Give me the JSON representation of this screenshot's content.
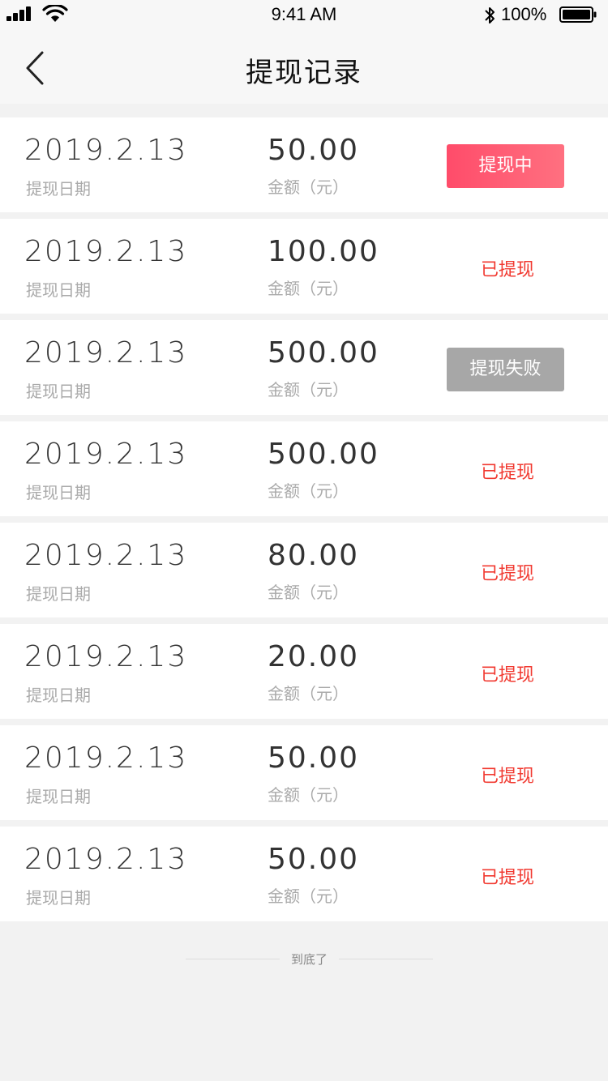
{
  "status_bar": {
    "time": "9:41 AM",
    "battery_percent": "100%"
  },
  "nav": {
    "title": "提现记录",
    "back_icon": "chevron-left-icon"
  },
  "labels": {
    "date_label": "提现日期",
    "amount_label": "金额（元）"
  },
  "records": [
    {
      "date": "2019.2.13",
      "amount": "50.00",
      "status": "提现中",
      "status_type": "pending"
    },
    {
      "date": "2019.2.13",
      "amount": "100.00",
      "status": "已提现",
      "status_type": "done"
    },
    {
      "date": "2019.2.13",
      "amount": "500.00",
      "status": "提现失败",
      "status_type": "failed"
    },
    {
      "date": "2019.2.13",
      "amount": "500.00",
      "status": "已提现",
      "status_type": "done"
    },
    {
      "date": "2019.2.13",
      "amount": "80.00",
      "status": "已提现",
      "status_type": "done"
    },
    {
      "date": "2019.2.13",
      "amount": "20.00",
      "status": "已提现",
      "status_type": "done"
    },
    {
      "date": "2019.2.13",
      "amount": "50.00",
      "status": "已提现",
      "status_type": "done"
    },
    {
      "date": "2019.2.13",
      "amount": "50.00",
      "status": "已提现",
      "status_type": "done"
    }
  ],
  "footer": {
    "end_text": "到底了"
  },
  "colors": {
    "pending_bg": "#ff5a70",
    "failed_bg": "#a7a7a7",
    "done_text": "#f13a31"
  }
}
